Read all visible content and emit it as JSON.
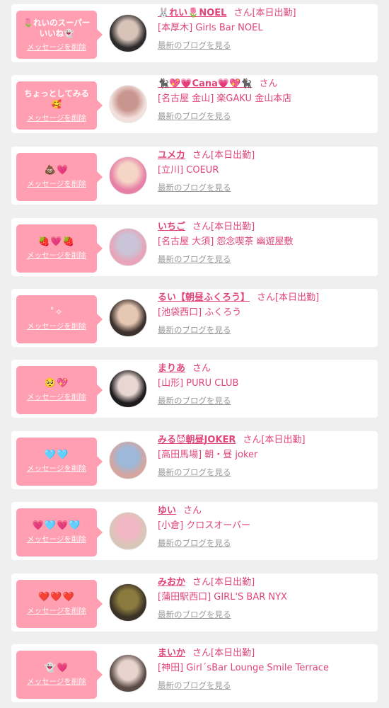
{
  "colors": {
    "accent": "#e0447a",
    "bubble": "#ff9fb1",
    "background": "#efefef",
    "link_gray": "#9a9a9a"
  },
  "ui": {
    "delete_label": "メッセージを削除",
    "blog_label": "最新のブログを見る",
    "san": "さん"
  },
  "entries": [
    {
      "message": "🌷れいのスーパー\nいいね👻",
      "name": "🐰れい🌷NOEL",
      "duty": "[本日出勤]",
      "shop": "[本厚木] Girls Bar NOEL",
      "avatar_colors": [
        "#2c2a2b",
        "#d8c3b8"
      ]
    },
    {
      "message": "ちょっとしてみる\n🥰",
      "name": "🐈‍⬛💖💗Cana💗💖🐈‍⬛",
      "duty": "",
      "shop": "[名古屋 金山] 楽GAKU 金山本店",
      "avatar_colors": [
        "#f3e0dc",
        "#c9968f"
      ]
    },
    {
      "message": "💩💗",
      "name": "ユメカ",
      "duty": "[本日出勤]",
      "shop": "[立川] COEUR",
      "avatar_colors": [
        "#e77fa6",
        "#f5d5c6"
      ]
    },
    {
      "message": "🍓💗🍓",
      "name": "いちご",
      "duty": "[本日出勤]",
      "shop": "[名古屋 大須] 怨念喫茶 幽遊屋敷",
      "avatar_colors": [
        "#e8a4b8",
        "#c9c4d8"
      ]
    },
    {
      "message": "˚✧",
      "name": "るい【朝昼ふくろう】",
      "duty": "[本日出勤]",
      "shop": "[池袋西口] ふくろう",
      "avatar_colors": [
        "#3b302b",
        "#e6c7b3"
      ]
    },
    {
      "message": "🥺💖",
      "name": "まりあ",
      "duty": "",
      "shop": "[山形] PURU CLUB",
      "avatar_colors": [
        "#1d1b1d",
        "#e8d6d2"
      ]
    },
    {
      "message": "🩵🩵",
      "name": "みる😈朝昼JOKER",
      "duty": "[本日出勤]",
      "shop": "[高田馬場] 朝・昼 joker",
      "avatar_colors": [
        "#d5a6a0",
        "#9db8d9"
      ]
    },
    {
      "message": "💗🩵💗🩵",
      "name": "ゆい",
      "duty": "",
      "shop": "[小倉] クロスオーバー",
      "avatar_colors": [
        "#d9c6b8",
        "#f1b6c3"
      ]
    },
    {
      "message": "❤️❤️❤️",
      "name": "みおか",
      "duty": "[本日出勤]",
      "shop": "[蒲田駅西口] GIRL'S BAR NYX",
      "avatar_colors": [
        "#3a3226",
        "#8a7a3e"
      ]
    },
    {
      "message": "👻💗",
      "name": "まいか",
      "duty": "[本日出勤]",
      "shop": "[神田] Girl´sBar Lounge Smile Terrace",
      "avatar_colors": [
        "#5a4b46",
        "#e8d4cc"
      ]
    }
  ]
}
